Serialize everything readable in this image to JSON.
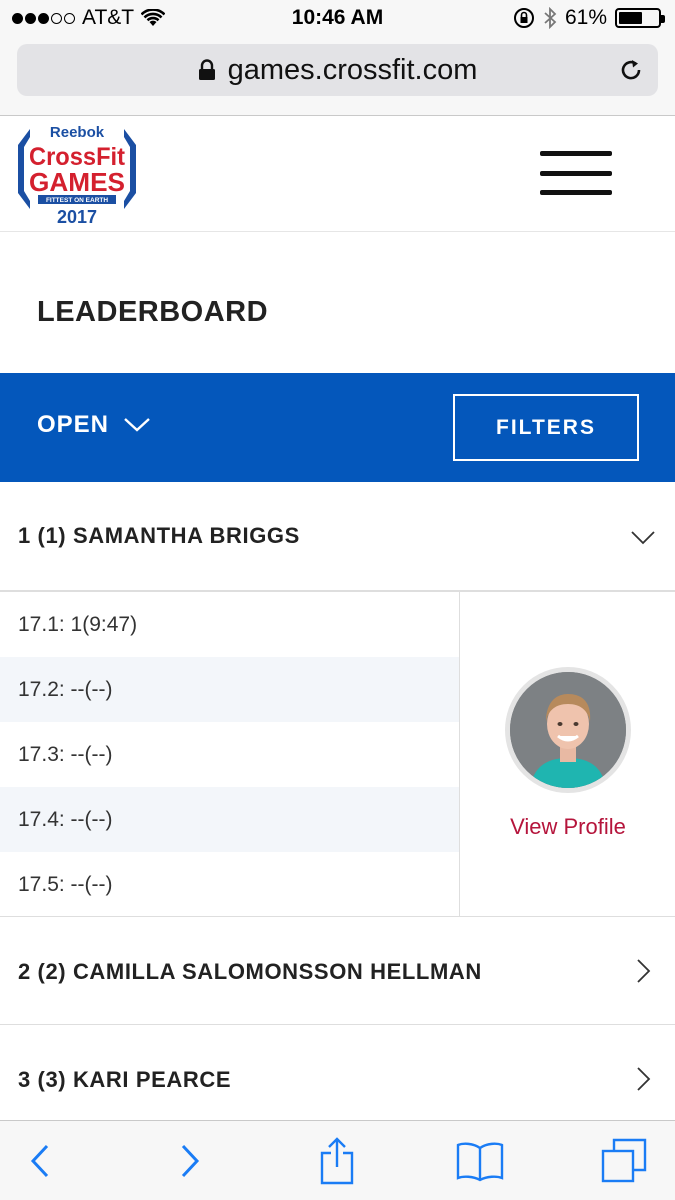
{
  "status_bar": {
    "carrier": "AT&T",
    "time": "10:46 AM",
    "battery": "61%",
    "battery_level": 0.61,
    "signal_bars_filled": 3,
    "signal_bars_total": 5
  },
  "browser": {
    "url": "games.crossfit.com"
  },
  "logo": {
    "brand": "Reebok",
    "line1": "CrossFit",
    "line2": "GAMES",
    "tagline": "FITTEST ON EARTH",
    "year": "2017"
  },
  "page": {
    "title": "LEADERBOARD"
  },
  "filter_bar": {
    "division": "OPEN",
    "filters_label": "FILTERS"
  },
  "athletes": [
    {
      "name": "1 (1) SAMANTHA BRIGGS",
      "expanded": true,
      "scores": [
        "17.1: 1(9:47)",
        "17.2: --(--)",
        "17.3: --(--)",
        "17.4: --(--)",
        "17.5: --(--)"
      ],
      "profile_link": "View Profile"
    },
    {
      "name": "2 (2) CAMILLA SALOMONSSON HELLMAN",
      "expanded": false
    },
    {
      "name": "3 (3) KARI PEARCE",
      "expanded": false
    }
  ],
  "colors": {
    "accent_blue": "#0457bb",
    "link_red": "#b5153c",
    "logo_red": "#d4202e",
    "logo_blue": "#1b4fa3"
  }
}
